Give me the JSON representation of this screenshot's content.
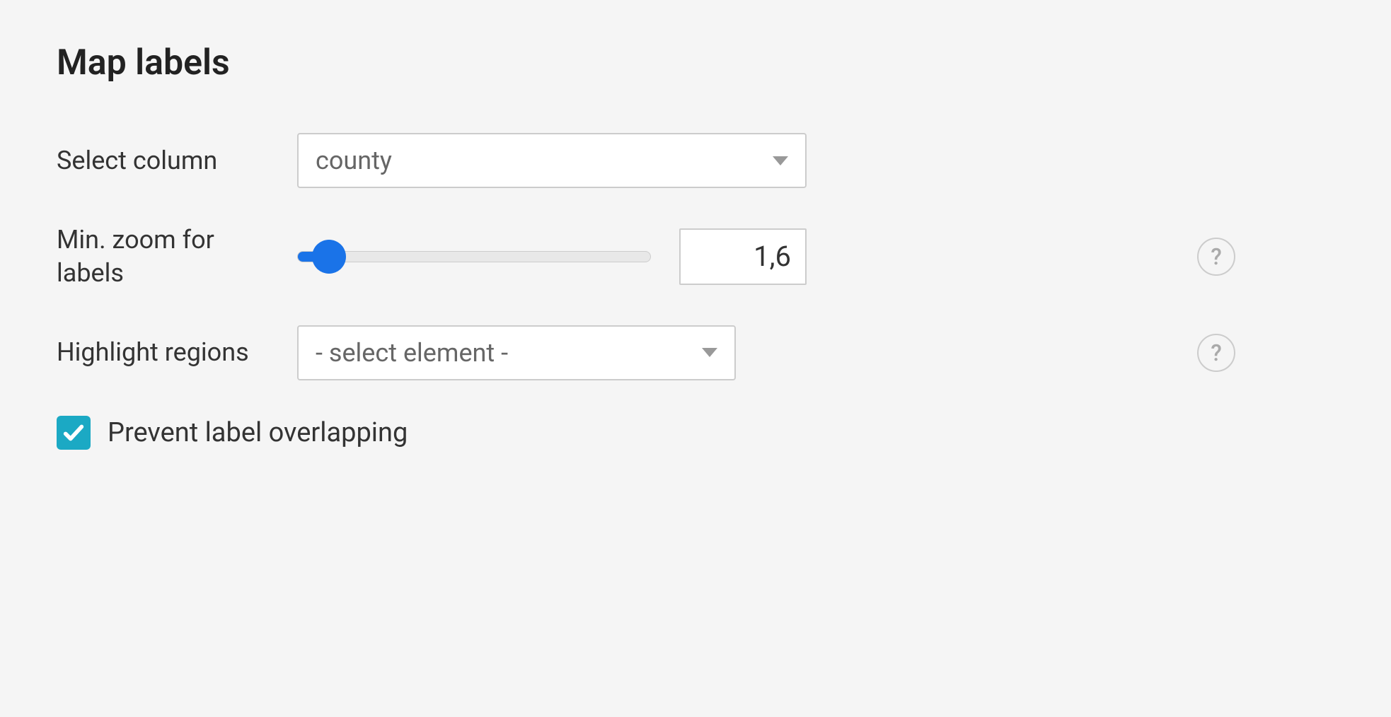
{
  "section": {
    "title": "Map labels"
  },
  "fields": {
    "select_column": {
      "label": "Select column",
      "value": "county"
    },
    "min_zoom": {
      "label": "Min. zoom for labels",
      "value": "1,6"
    },
    "highlight_regions": {
      "label": "Highlight regions",
      "value": "- select element -"
    },
    "prevent_overlap": {
      "label": "Prevent label overlapping",
      "checked": true
    }
  },
  "icons": {
    "help": "?"
  }
}
